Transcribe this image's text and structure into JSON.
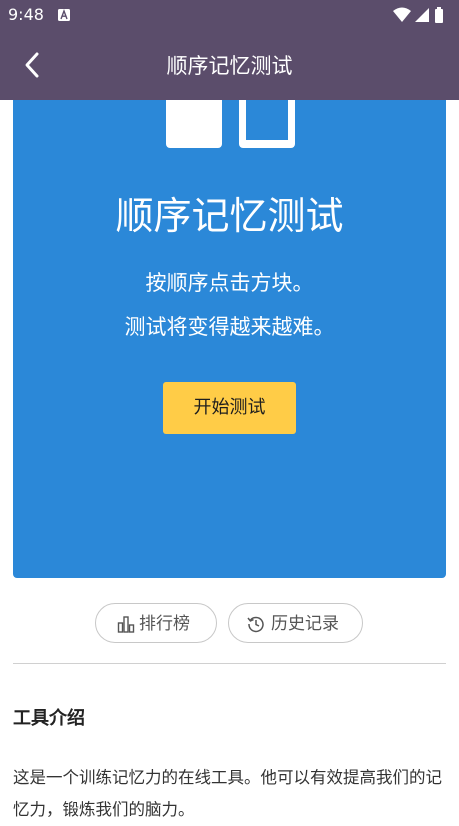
{
  "status_bar": {
    "time": "9:48",
    "icons": [
      "notification-a-icon",
      "wifi-icon",
      "signal-icon",
      "battery-icon"
    ]
  },
  "app_bar": {
    "title": "顺序记忆测试",
    "back_icon": "chevron-left-icon"
  },
  "hero": {
    "background_color": "#2b88d8",
    "title": "顺序记忆测试",
    "description_line1": "按顺序点击方块。",
    "description_line2": "测试将变得越来越难。",
    "start_button": "开始测试",
    "start_button_color": "#ffcc47"
  },
  "actions": {
    "leaderboard_label": "排行榜",
    "leaderboard_icon": "bar-chart-icon",
    "history_label": "历史记录",
    "history_icon": "history-icon"
  },
  "intro": {
    "heading": "工具介绍",
    "body": "这是一个训练记忆力的在线工具。他可以有效提高我们的记忆力，锻炼我们的脑力。"
  },
  "colors": {
    "app_bar": "#5b4d6b",
    "accent": "#2b88d8"
  }
}
